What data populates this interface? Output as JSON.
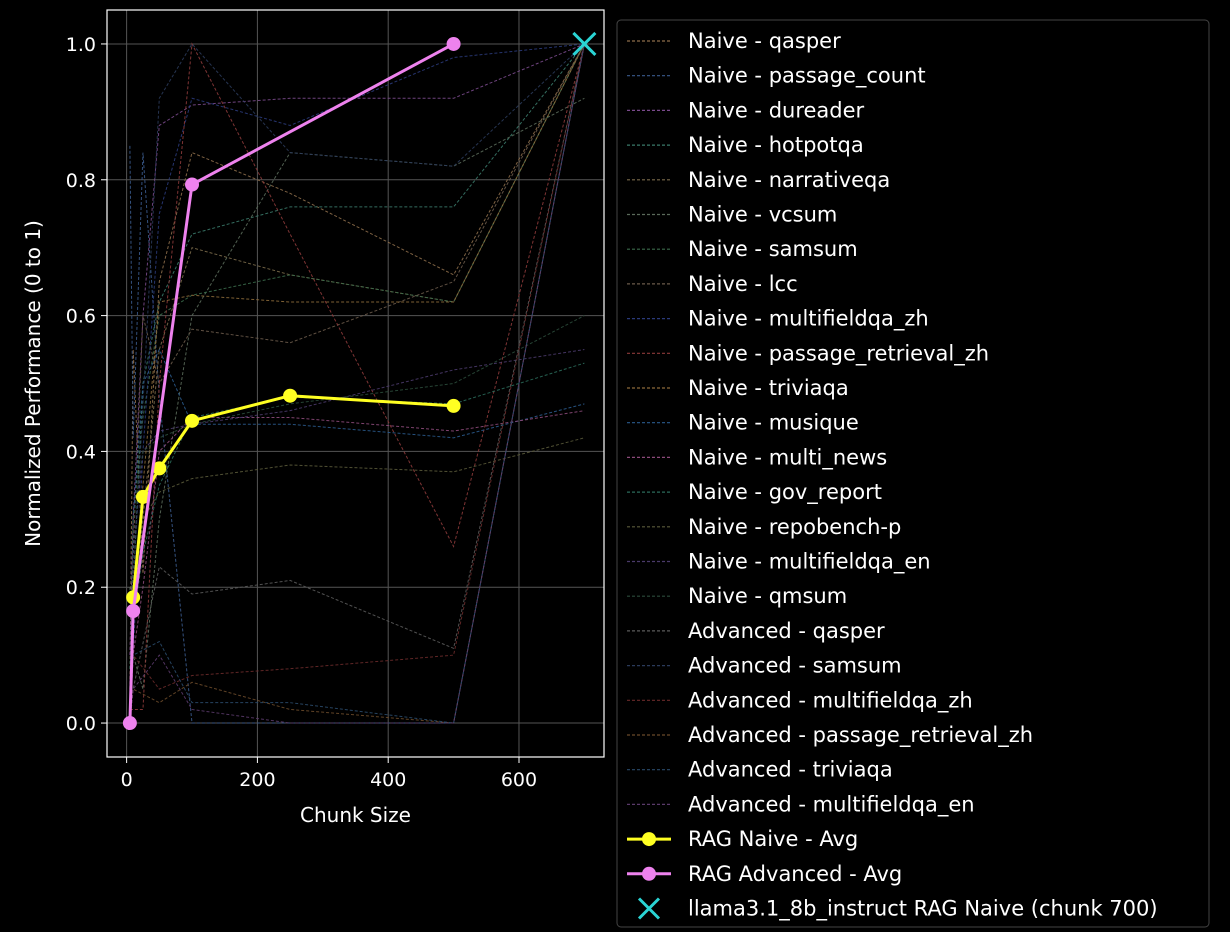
{
  "chart_data": {
    "type": "line",
    "title": "",
    "xlabel": "Chunk Size",
    "ylabel": "Normalized Performance (0 to 1)",
    "xlim": [
      -30,
      730
    ],
    "ylim": [
      -0.05,
      1.05
    ],
    "xticks": [
      0,
      200,
      400,
      600
    ],
    "yticks": [
      0.0,
      0.2,
      0.4,
      0.6,
      0.8,
      1.0
    ],
    "xtick_labels": [
      "0",
      "200",
      "400",
      "600"
    ],
    "ytick_labels": [
      "0.0",
      "0.2",
      "0.4",
      "0.6",
      "0.8",
      "1.0"
    ],
    "grid": true,
    "legend_position": "outside-right",
    "background": "#000000",
    "series": [
      {
        "name": "Naive - qasper",
        "color": "#8c6d4a",
        "style": "dashed",
        "x": [
          5,
          10,
          25,
          50,
          100,
          250,
          500,
          700
        ],
        "y": [
          0.05,
          0.55,
          0.22,
          0.65,
          0.84,
          0.78,
          0.66,
          1.0
        ]
      },
      {
        "name": "Naive - passage_count",
        "color": "#3a5a8c",
        "style": "dashed",
        "x": [
          5,
          10,
          25,
          50,
          100,
          250,
          500,
          700
        ],
        "y": [
          0.85,
          0.42,
          0.84,
          0.48,
          0.0,
          0.0,
          0.0,
          1.0
        ]
      },
      {
        "name": "Naive - dureader",
        "color": "#7a4a8c",
        "style": "dashed",
        "x": [
          5,
          10,
          25,
          50,
          100,
          250,
          500,
          700
        ],
        "y": [
          0.1,
          0.3,
          0.6,
          0.88,
          0.91,
          0.92,
          0.92,
          1.0
        ]
      },
      {
        "name": "Naive - hotpotqa",
        "color": "#3a7a6a",
        "style": "dashed",
        "x": [
          5,
          10,
          25,
          50,
          100,
          250,
          500,
          700
        ],
        "y": [
          0.08,
          0.2,
          0.5,
          0.62,
          0.72,
          0.76,
          0.76,
          1.0
        ]
      },
      {
        "name": "Naive - narrativeqa",
        "color": "#7a6a4a",
        "style": "dashed",
        "x": [
          5,
          10,
          25,
          50,
          100,
          250,
          500,
          700
        ],
        "y": [
          0.0,
          0.15,
          0.3,
          0.55,
          0.7,
          0.66,
          0.62,
          1.0
        ]
      },
      {
        "name": "Naive - vcsum",
        "color": "#5a6a5a",
        "style": "dashed",
        "x": [
          5,
          10,
          25,
          50,
          100,
          250,
          500,
          700
        ],
        "y": [
          0.2,
          0.1,
          0.05,
          0.3,
          0.6,
          0.84,
          0.82,
          0.92
        ]
      },
      {
        "name": "Naive - samsum",
        "color": "#3a6a4a",
        "style": "dashed",
        "x": [
          5,
          10,
          25,
          50,
          100,
          250,
          500,
          700
        ],
        "y": [
          0.0,
          0.3,
          0.45,
          0.6,
          0.63,
          0.66,
          0.62,
          1.0
        ]
      },
      {
        "name": "Naive - lcc",
        "color": "#6a5a4a",
        "style": "dashed",
        "x": [
          5,
          10,
          25,
          50,
          100,
          250,
          500,
          700
        ],
        "y": [
          0.0,
          0.25,
          0.6,
          0.5,
          0.58,
          0.56,
          0.65,
          1.0
        ]
      },
      {
        "name": "Naive - multifieldqa_zh",
        "color": "#2a3a7a",
        "style": "dashed",
        "x": [
          5,
          10,
          25,
          50,
          100,
          250,
          500,
          700
        ],
        "y": [
          0.0,
          0.1,
          0.4,
          0.75,
          0.92,
          0.88,
          0.98,
          1.0
        ]
      },
      {
        "name": "Naive - passage_retrieval_zh",
        "color": "#8c3a3a",
        "style": "dashed",
        "x": [
          5,
          10,
          25,
          50,
          100,
          250,
          500,
          700
        ],
        "y": [
          0.02,
          0.02,
          0.02,
          0.5,
          1.0,
          0.72,
          0.26,
          1.0
        ]
      },
      {
        "name": "Naive - triviaqa",
        "color": "#8c6a3a",
        "style": "dashed",
        "x": [
          5,
          10,
          25,
          50,
          100,
          250,
          500,
          700
        ],
        "y": [
          0.0,
          0.2,
          0.35,
          0.62,
          0.63,
          0.62,
          0.62,
          1.0
        ]
      },
      {
        "name": "Naive - musique",
        "color": "#2a5a8c",
        "style": "dashed",
        "x": [
          5,
          10,
          25,
          50,
          100,
          250,
          500,
          700
        ],
        "y": [
          0.0,
          0.3,
          0.5,
          0.55,
          0.44,
          0.44,
          0.42,
          0.47
        ]
      },
      {
        "name": "Naive - multi_news",
        "color": "#8c4a7a",
        "style": "dashed",
        "x": [
          5,
          10,
          25,
          50,
          100,
          250,
          500,
          700
        ],
        "y": [
          0.0,
          0.1,
          0.2,
          0.4,
          0.45,
          0.45,
          0.43,
          0.46
        ]
      },
      {
        "name": "Naive - gov_report",
        "color": "#2a6a5a",
        "style": "dashed",
        "x": [
          5,
          10,
          25,
          50,
          100,
          250,
          500,
          700
        ],
        "y": [
          0.0,
          0.15,
          0.25,
          0.35,
          0.45,
          0.48,
          0.47,
          0.53
        ]
      },
      {
        "name": "Naive - repobench-p",
        "color": "#5a5a3a",
        "style": "dashed",
        "x": [
          5,
          10,
          25,
          50,
          100,
          250,
          500,
          700
        ],
        "y": [
          0.0,
          0.2,
          0.3,
          0.34,
          0.36,
          0.38,
          0.37,
          0.42
        ]
      },
      {
        "name": "Naive - multifieldqa_en",
        "color": "#4a3a6a",
        "style": "dashed",
        "x": [
          5,
          10,
          25,
          50,
          100,
          250,
          500,
          700
        ],
        "y": [
          0.0,
          0.25,
          0.4,
          0.43,
          0.44,
          0.46,
          0.52,
          0.55
        ]
      },
      {
        "name": "Naive - qmsum",
        "color": "#2a4a3a",
        "style": "dashed",
        "x": [
          5,
          10,
          25,
          50,
          100,
          250,
          500,
          700
        ],
        "y": [
          0.0,
          0.3,
          0.4,
          0.42,
          0.44,
          0.47,
          0.5,
          0.6
        ]
      },
      {
        "name": "Advanced - qasper",
        "color": "#5a5a5a",
        "style": "dashed",
        "x": [
          5,
          10,
          50,
          100,
          250,
          500,
          700
        ],
        "y": [
          0.0,
          0.05,
          0.23,
          0.19,
          0.21,
          0.11,
          1.0
        ]
      },
      {
        "name": "Advanced - samsum",
        "color": "#2a3a5a",
        "style": "dashed",
        "x": [
          5,
          10,
          50,
          100,
          250,
          500,
          700
        ],
        "y": [
          0.0,
          0.2,
          0.92,
          1.0,
          0.84,
          0.82,
          1.0
        ]
      },
      {
        "name": "Advanced - multifieldqa_zh",
        "color": "#6a2a2a",
        "style": "dashed",
        "x": [
          5,
          10,
          50,
          100,
          250,
          500,
          700
        ],
        "y": [
          0.0,
          0.1,
          0.05,
          0.07,
          0.08,
          0.1,
          1.0
        ]
      },
      {
        "name": "Advanced - passage_retrieval_zh",
        "color": "#6a4a2a",
        "style": "dashed",
        "x": [
          5,
          10,
          50,
          100,
          250,
          500,
          700
        ],
        "y": [
          0.0,
          0.05,
          0.03,
          0.06,
          0.02,
          0.0,
          1.0
        ]
      },
      {
        "name": "Advanced - triviaqa",
        "color": "#2a4a6a",
        "style": "dashed",
        "x": [
          5,
          10,
          50,
          100,
          250,
          500,
          700
        ],
        "y": [
          0.0,
          0.1,
          0.12,
          0.03,
          0.03,
          0.0,
          1.0
        ]
      },
      {
        "name": "Advanced - multifieldqa_en",
        "color": "#5a3a6a",
        "style": "dashed",
        "x": [
          5,
          10,
          50,
          100,
          250,
          500,
          700
        ],
        "y": [
          0.0,
          0.05,
          0.1,
          0.02,
          0.0,
          0.0,
          1.0
        ]
      },
      {
        "name": "RAG Naive - Avg",
        "color": "#ffff22",
        "style": "solid-marker",
        "x": [
          10,
          25,
          50,
          100,
          250,
          500
        ],
        "y": [
          0.185,
          0.333,
          0.375,
          0.445,
          0.482,
          0.467
        ]
      },
      {
        "name": "RAG Advanced - Avg",
        "color": "#ee82ee",
        "style": "solid-marker",
        "x": [
          5,
          10,
          100,
          500
        ],
        "y": [
          0.0,
          0.165,
          0.793,
          1.0
        ]
      },
      {
        "name": "llama3.1_8b_instruct RAG Naive (chunk 700)",
        "color": "#2ad4d4",
        "style": "x-marker",
        "x": [
          700
        ],
        "y": [
          1.0
        ]
      }
    ]
  }
}
